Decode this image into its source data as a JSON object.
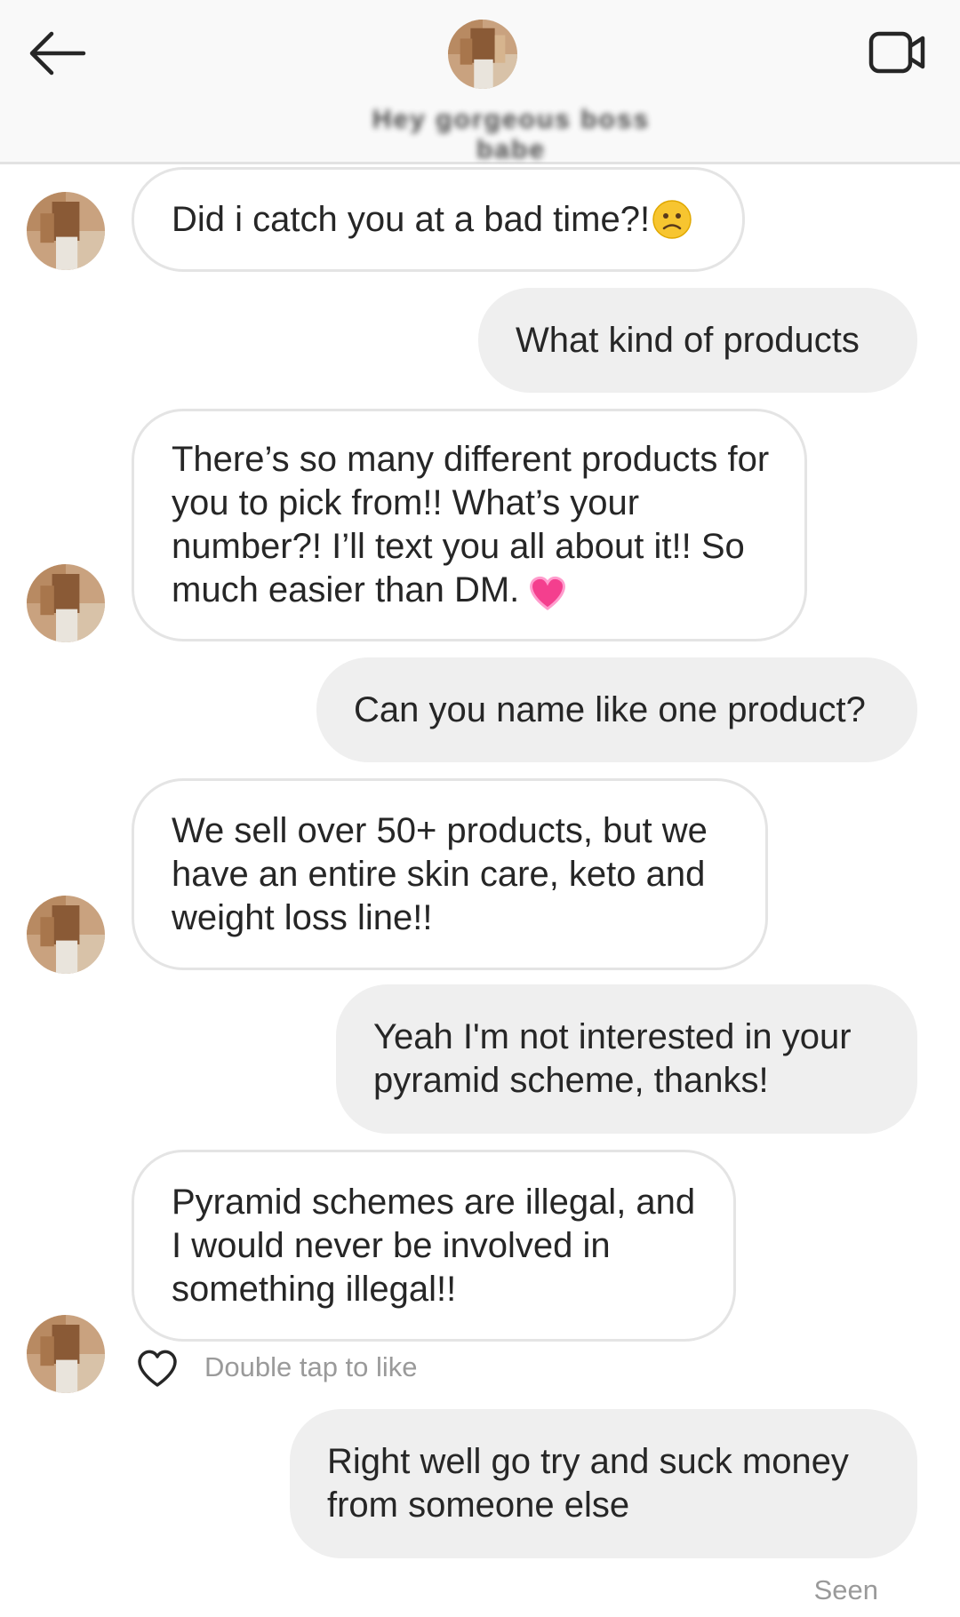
{
  "header": {
    "contact_name": "Hey gorgeous boss babe",
    "back_icon": "arrow-left-icon",
    "video_icon": "video-camera-icon",
    "avatar_icon": "profile-photo"
  },
  "messages": [
    {
      "from": "contact",
      "text": "Did i catch you at a bad time?!",
      "emoji": "slightly-frowning-face"
    },
    {
      "from": "me",
      "text": "What kind of products"
    },
    {
      "from": "contact",
      "text": "There’s so many different products for you to pick from!! What’s your number?! I’ll text you all about it!! So much easier than DM.",
      "emoji": "pink-heart"
    },
    {
      "from": "me",
      "text": "Can you name like one product?"
    },
    {
      "from": "contact",
      "text": "We sell over 50+ products, but we have an entire skin care, keto and weight loss line!!"
    },
    {
      "from": "me",
      "text": "Yeah I'm not interested in your pyramid scheme, thanks!"
    },
    {
      "from": "contact",
      "text": "Pyramid schemes are illegal, and I would never be involved in something illegal!!"
    },
    {
      "from": "me",
      "text": "Right well go try and suck money from someone else"
    }
  ],
  "like_hint": "Double tap to like",
  "like_icon": "heart-outline-icon",
  "seen_label": "Seen",
  "colors": {
    "outgoing_bubble": "#efefef",
    "incoming_border": "#e4e4e4",
    "header_bg": "#f9f9f9",
    "muted_text": "#9a9a9a"
  }
}
